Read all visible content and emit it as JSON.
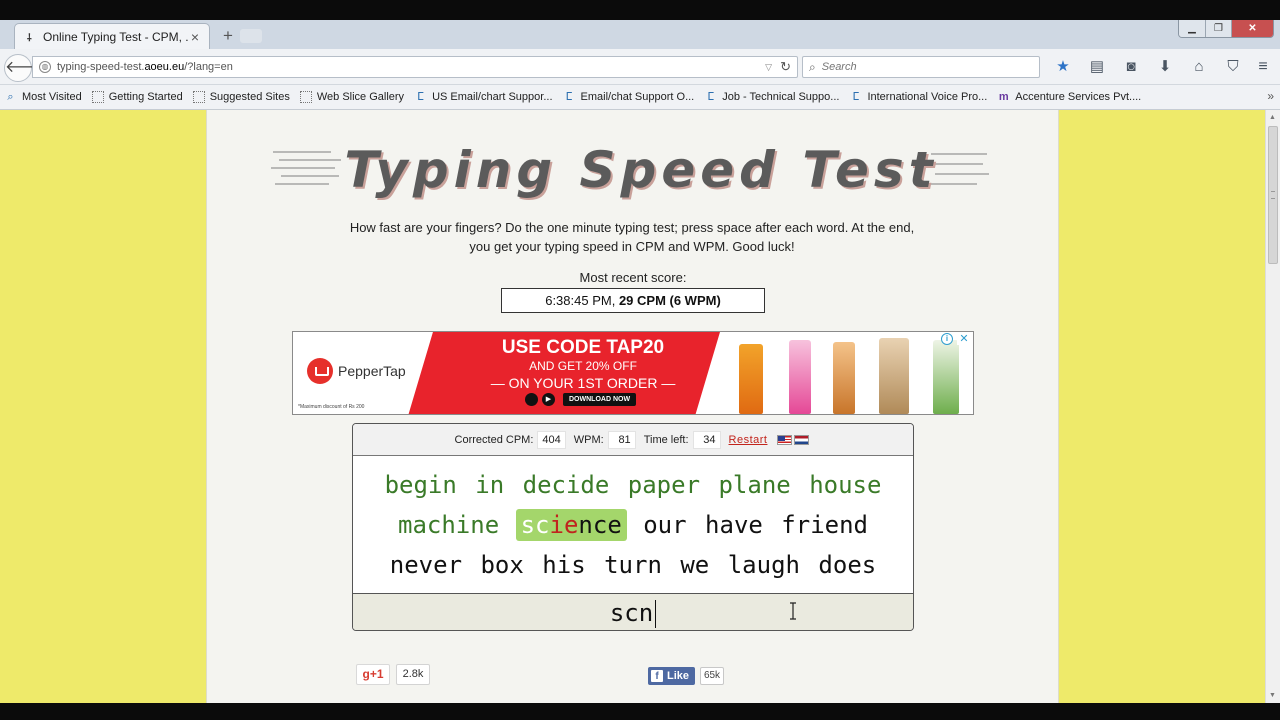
{
  "browser": {
    "tab_title": "Online Typing Test - CPM, ...",
    "url_prefix": "typing-speed-test.",
    "url_domain": "aoeu.eu",
    "url_suffix": "/?lang=en",
    "search_placeholder": "Search",
    "bookmarks": [
      {
        "label": "Most Visited",
        "icon": "most-visited-icon"
      },
      {
        "label": "Getting Started",
        "icon": "blank-page-icon"
      },
      {
        "label": "Suggested Sites",
        "icon": "blank-page-icon"
      },
      {
        "label": "Web Slice Gallery",
        "icon": "blank-page-icon"
      },
      {
        "label": "US Email/chart Suppor...",
        "icon": "site-icon"
      },
      {
        "label": "Email/chat Support O...",
        "icon": "site-icon"
      },
      {
        "label": "Job - Technical Suppo...",
        "icon": "site-icon"
      },
      {
        "label": "International Voice Pro...",
        "icon": "site-icon"
      },
      {
        "label": "Accenture Services Pvt....",
        "icon": "m-icon"
      }
    ]
  },
  "page": {
    "logo_text": "Typing Speed Test",
    "intro": "How fast are your fingers? Do the one minute typing test; press space after each word. At the end, you get your typing speed in CPM and WPM. Good luck!",
    "recent_label": "Most recent score:",
    "recent_time": "6:38:45 PM, ",
    "recent_score": "29 CPM (6 WPM)"
  },
  "ad": {
    "brand": "PepperTap",
    "code_line": "USE CODE TAP20",
    "offer_line": "AND GET 20% OFF",
    "order_line": "— ON YOUR 1ST ORDER —",
    "download": "DOWNLOAD NOW",
    "disclaimer": "*Maximum discount of Rs 200"
  },
  "test": {
    "corrected_cpm_label": "Corrected CPM:",
    "corrected_cpm": "404",
    "wpm_label": "WPM:",
    "wpm": "81",
    "time_left_label": "Time left:",
    "time_left": "34",
    "restart": "Restart",
    "line1": [
      "begin",
      "in",
      "decide",
      "paper",
      "plane",
      "house"
    ],
    "line2_before": [
      "machine"
    ],
    "current_ok": "sc",
    "current_bad": "ie",
    "current_rest": "nce",
    "line2_after": [
      "our",
      "have",
      "friend"
    ],
    "line3": [
      "never",
      "box",
      "his",
      "turn",
      "we",
      "laugh",
      "does"
    ],
    "typed": "scn"
  },
  "social": {
    "gplus": "g+1",
    "gplus_count": "2.8k",
    "fb_like": "Like",
    "fb_count": "65k"
  },
  "colors": {
    "page_bg": "#eeea6a",
    "done_word": "#3a7a28",
    "current_word_bg": "#a4d66b",
    "error_char": "#c0241e",
    "restart_link": "#c2241c"
  }
}
